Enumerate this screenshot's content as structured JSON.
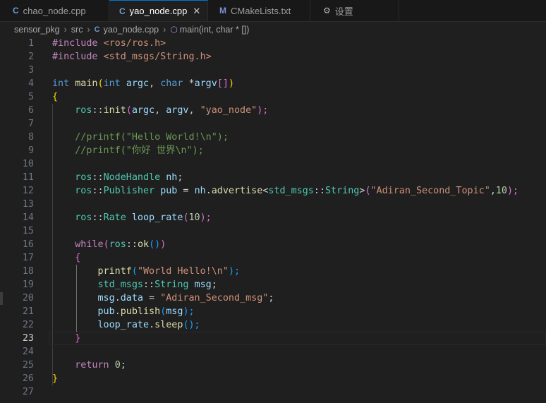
{
  "tabs": [
    {
      "label": "chao_node.cpp",
      "icon": "C",
      "active": false
    },
    {
      "label": "yao_node.cpp",
      "icon": "C",
      "active": true
    },
    {
      "label": "CMakeLists.txt",
      "icon": "M",
      "active": false
    },
    {
      "label": "设置",
      "icon": "⚙",
      "active": false
    }
  ],
  "breadcrumb": {
    "folder1": "sensor_pkg",
    "folder2": "src",
    "file": "yao_node.cpp",
    "symbol": "main(int, char * [])"
  },
  "editor": {
    "current_line": 23,
    "line_numbers": [
      "1",
      "2",
      "3",
      "4",
      "5",
      "6",
      "7",
      "8",
      "9",
      "10",
      "11",
      "12",
      "13",
      "14",
      "15",
      "16",
      "17",
      "18",
      "19",
      "20",
      "21",
      "22",
      "23",
      "24",
      "25",
      "26",
      "27"
    ],
    "code": {
      "l1": [
        "#include",
        " ",
        "<ros/ros.h>"
      ],
      "l2": [
        "#include",
        " ",
        "<std_msgs/String.h>"
      ],
      "l4": [
        "int",
        " ",
        "main",
        "(",
        "int",
        " ",
        "argc",
        ", ",
        "char",
        " *",
        "argv",
        "[]",
        ")"
      ],
      "l5": [
        "{"
      ],
      "l6": [
        "    ",
        "ros",
        "::",
        "init",
        "(",
        "argc",
        ", ",
        "argv",
        ", ",
        "\"yao_node\"",
        ");"
      ],
      "l8": [
        "    //printf(\"Hello World!\\n\");"
      ],
      "l9": [
        "    //printf(\"你好 世界\\n\");"
      ],
      "l11": [
        "    ",
        "ros",
        "::",
        "NodeHandle",
        " ",
        "nh",
        ";"
      ],
      "l12": [
        "    ",
        "ros",
        "::",
        "Publisher",
        " ",
        "pub",
        " = ",
        "nh",
        ".",
        "advertise",
        "<",
        "std_msgs",
        "::",
        "String",
        ">",
        "(",
        "\"Adiran_Second_Topic\"",
        ",",
        "10",
        ");"
      ],
      "l14": [
        "    ",
        "ros",
        "::",
        "Rate",
        " ",
        "loop_rate",
        "(",
        "10",
        ");"
      ],
      "l16": [
        "    ",
        "while",
        "(",
        "ros",
        "::",
        "ok",
        "()",
        ")"
      ],
      "l17": [
        "    ",
        "{"
      ],
      "l18": [
        "        ",
        "printf",
        "(",
        "\"World Hello!\\n\"",
        ");"
      ],
      "l19": [
        "        ",
        "std_msgs",
        "::",
        "String",
        " ",
        "msg",
        ";"
      ],
      "l20": [
        "        ",
        "msg",
        ".",
        "data",
        " = ",
        "\"Adiran_Second_msg\"",
        ";"
      ],
      "l21": [
        "        ",
        "pub",
        ".",
        "publish",
        "(",
        "msg",
        ");"
      ],
      "l22": [
        "        ",
        "loop_rate",
        ".",
        "sleep",
        "();"
      ],
      "l23": [
        "    ",
        "}"
      ],
      "l25": [
        "    ",
        "return",
        " ",
        "0",
        ";"
      ],
      "l26": [
        "}"
      ]
    }
  },
  "colors": {
    "background": "#1f1f1f",
    "keyword": "#569cd6",
    "control": "#c586c0",
    "string": "#ce9178",
    "function": "#dcdcaa",
    "type": "#4ec9b0",
    "variable": "#9cdcfe",
    "number": "#b5cea8",
    "comment": "#6a9955"
  }
}
